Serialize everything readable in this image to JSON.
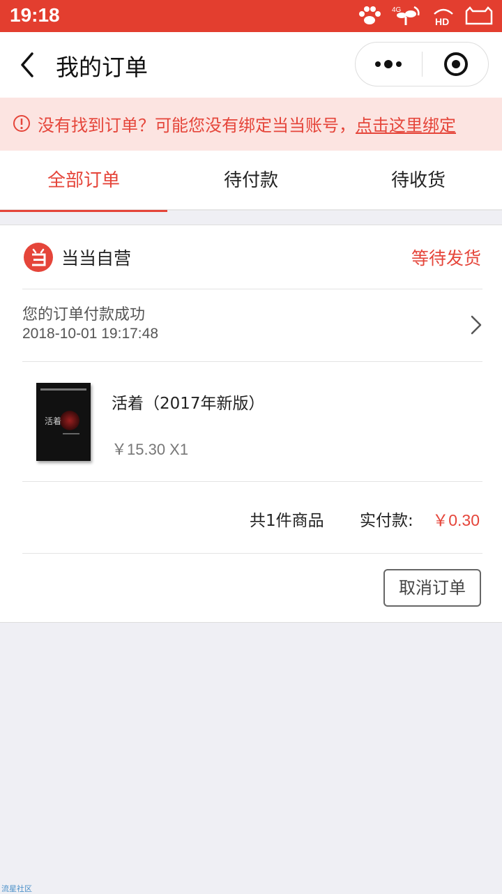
{
  "status_bar": {
    "time": "19:18",
    "network_label": "4G",
    "hd_label": "HD",
    "icons": [
      "paw-icon",
      "signal-sprout-icon",
      "hd-wifi-icon",
      "battery-cat-icon"
    ]
  },
  "nav": {
    "title": "我的订单",
    "back_icon": "chevron-left-icon",
    "capsule": {
      "more_icon": "more-dots-icon",
      "close_icon": "target-circle-icon"
    }
  },
  "notice": {
    "icon": "info-circle-icon",
    "text": "没有找到订单？可能您没有绑定当当账号，",
    "link_text": "点击这里绑定"
  },
  "tabs": [
    {
      "label": "全部订单",
      "active": true
    },
    {
      "label": "待付款",
      "active": false
    },
    {
      "label": "待收货",
      "active": false
    }
  ],
  "order": {
    "shop_logo_icon": "dangdang-logo-icon",
    "shop_name": "当当自营",
    "status": "等待发货",
    "payment_message": "您的订单付款成功",
    "payment_time": "2018-10-01 19:17:48",
    "product": {
      "title": "活着（2017年新版）",
      "price_line": "￥15.30 X1",
      "cover_title": "活着"
    },
    "item_count_text": "共1件商品",
    "paid_label": "实付款:",
    "paid_amount": "￥0.30",
    "cancel_label": "取消订单"
  },
  "colors": {
    "brand_red": "#e33e2f",
    "accent_red": "#e5453a",
    "notice_bg": "#fce4e1",
    "page_bg": "#efeff4"
  },
  "watermark": "流星社区"
}
